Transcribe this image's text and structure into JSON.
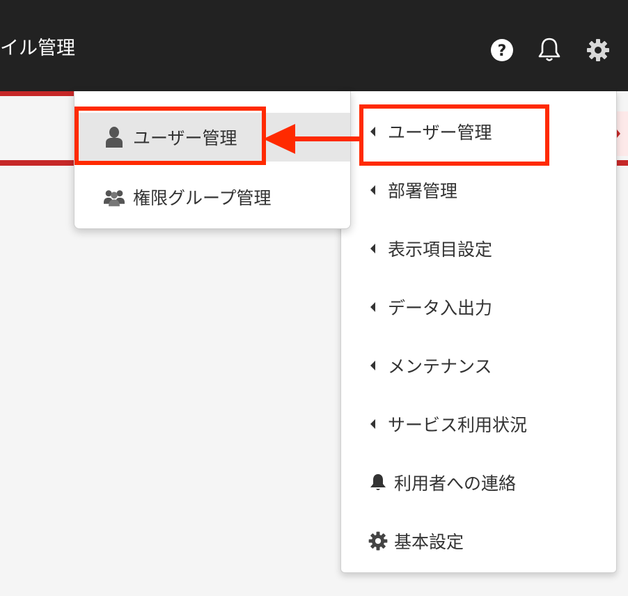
{
  "header": {
    "title": "イル管理",
    "icons": [
      "help-icon",
      "bell-icon",
      "gear-icon"
    ]
  },
  "settings_menu": {
    "items": [
      {
        "label": "ユーザー管理",
        "icon": "caret-left-icon"
      },
      {
        "label": "部署管理",
        "icon": "caret-left-icon"
      },
      {
        "label": "表示項目設定",
        "icon": "caret-left-icon"
      },
      {
        "label": "データ入出力",
        "icon": "caret-left-icon"
      },
      {
        "label": "メンテナンス",
        "icon": "caret-left-icon"
      },
      {
        "label": "サービス利用状況",
        "icon": "caret-left-icon"
      },
      {
        "label": "利用者への連絡",
        "icon": "bell-icon"
      },
      {
        "label": "基本設定",
        "icon": "gear-icon"
      }
    ]
  },
  "user_submenu": {
    "items": [
      {
        "label": "ユーザー管理",
        "icon": "user-icon"
      },
      {
        "label": "権限グループ管理",
        "icon": "user-group-icon"
      }
    ]
  },
  "colors": {
    "header_bg": "#222222",
    "accent_red": "#c62828",
    "annotation": "#ff2a00"
  }
}
